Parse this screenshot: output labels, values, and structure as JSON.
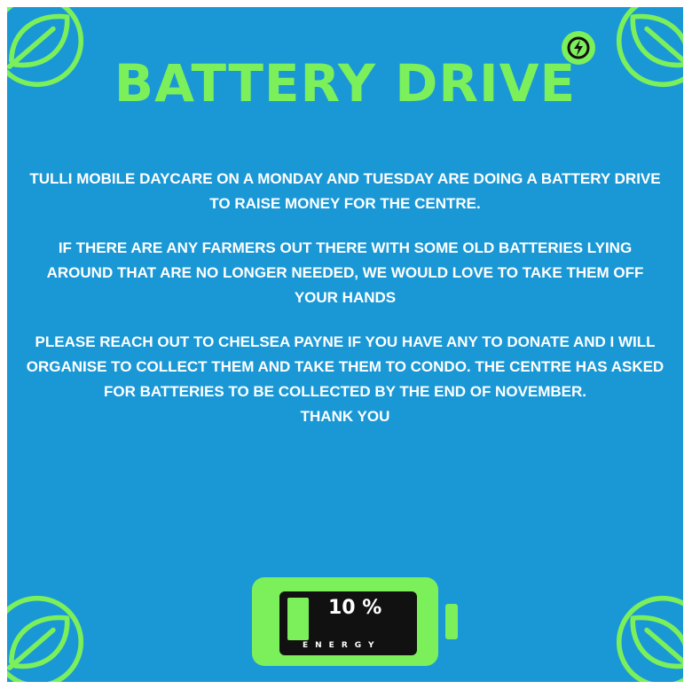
{
  "poster": {
    "title": "BATTERY DRIVE",
    "paragraphs": [
      "TULLI MOBILE DAYCARE ON A MONDAY AND TUESDAY ARE DOING A BATTERY DRIVE TO RAISE MONEY FOR THE CENTRE.",
      "IF THERE ARE ANY FARMERS OUT THERE WITH SOME OLD BATTERIES LYING AROUND THAT ARE NO LONGER NEEDED, WE WOULD LOVE TO TAKE THEM OFF YOUR HANDS",
      "PLEASE REACH OUT TO CHELSEA PAYNE IF YOU HAVE ANY TO DONATE AND I WILL ORGANISE TO COLLECT THEM AND TAKE THEM TO CONDO. THE CENTRE HAS ASKED FOR BATTERIES TO BE COLLECTED BY THE END OF NOVEMBER."
    ],
    "thanks": "THANK YOU",
    "battery": {
      "percent_label": "10 %",
      "energy_label": "ENERGY",
      "level": 0.1
    }
  },
  "colors": {
    "background": "#1a98d6",
    "accent": "#7cf05a",
    "text": "#ffffff",
    "screen": "#111111"
  },
  "icons": [
    "leaf-icon",
    "lightning-bolt-icon",
    "battery-icon"
  ]
}
